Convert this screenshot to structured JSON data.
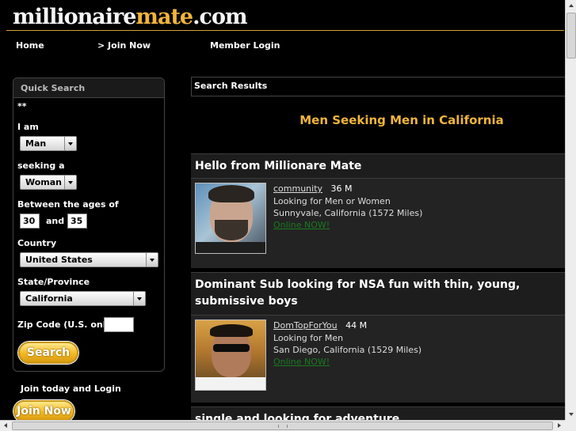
{
  "header": {
    "logo": {
      "part1": "millionaire",
      "part2": "mate",
      "part3": ".com"
    },
    "nav": [
      {
        "label": "Home"
      },
      {
        "label": "> Join Now"
      },
      {
        "label": "Member Login"
      }
    ]
  },
  "quick_search": {
    "title": "Quick Search",
    "marker": "**",
    "i_am_label": "I am",
    "i_am_value": "Man",
    "seeking_label": "seeking a",
    "seeking_value": "Woman",
    "ages_label": "Between the ages of",
    "age_min": "30",
    "age_and": "and",
    "age_max": "35",
    "country_label": "Country",
    "country_value": "United States",
    "state_label": "State/Province",
    "state_value": "California",
    "zip_label": "Zip Code (U.S. only)",
    "zip_value": "",
    "search_button": "Search"
  },
  "join": {
    "label": "Join today and Login",
    "button": "Join Now"
  },
  "results": {
    "header": "Search Results",
    "title": "Men Seeking Men in California",
    "profiles": [
      {
        "headline": "Hello from Millionare Mate",
        "username": "community",
        "age_gender": "36 M",
        "looking": "Looking for Men or Women",
        "location": "Sunnyvale, California (1572 Miles)",
        "status": "Online NOW!"
      },
      {
        "headline_line1": "Dominant Sub looking for NSA fun with thin, young,",
        "headline_line2": "submissive boys",
        "username": "DomTopForYou",
        "age_gender": "44 M",
        "looking": "Looking for Men",
        "location": "San Diego, California (1529 Miles)",
        "status": "Online NOW!"
      },
      {
        "headline": "single and looking for adventure"
      }
    ]
  },
  "colors": {
    "accent": "#f0b53c",
    "online": "#197a1f",
    "background": "#000000"
  }
}
